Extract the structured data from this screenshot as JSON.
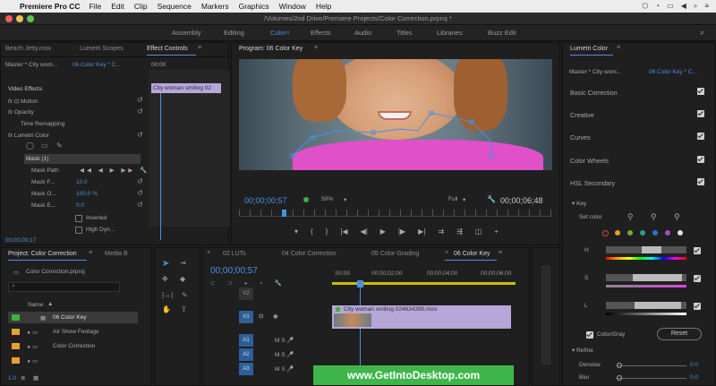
{
  "menubar": {
    "app": "Premiere Pro CC",
    "items": [
      "File",
      "Edit",
      "Clip",
      "Sequence",
      "Markers",
      "Graphics",
      "Window",
      "Help"
    ]
  },
  "window": {
    "title": "/Volumes/2nd Drive/Premiere Projects/Color Correction.prproj *"
  },
  "workspaces": [
    "Assembly",
    "Editing",
    "Color",
    "Effects",
    "Audio",
    "Titles",
    "Libraries",
    "Buzz Edit"
  ],
  "left_panel": {
    "tabs": [
      "Beach Jetty.mov",
      "Lumetri Scopes",
      "Effect Controls"
    ],
    "master": "Master * City wom...",
    "sequence": "06 Color Key * C...",
    "ruler_start": "00:00",
    "clip_bar": "City woman smiling 02",
    "video_effects": "Video Effects",
    "motion": "Motion",
    "opacity": "Opacity",
    "time_remapping": "Time Remapping",
    "lumetri": "Lumetri Color",
    "mask": "Mask (1)",
    "mask_path": "Mask Path",
    "mask_feather_label": "Mask F...",
    "mask_feather_val": "10.0",
    "mask_opacity_label": "Mask O...",
    "mask_opacity_val": "100.0 %",
    "mask_expansion_label": "Mask E...",
    "mask_expansion_val": "0.0",
    "inverted": "Inverted",
    "high_dyn": "High Dyn...",
    "timecode": "00;00;00;17"
  },
  "program": {
    "title": "Program: 06 Color Key",
    "timecode_in": "00;00;00;57",
    "zoom": "50%",
    "quality": "Full",
    "timecode_out": "00;00;06;48"
  },
  "lumetri_panel": {
    "title": "Lumetri Color",
    "master": "Master * City wom...",
    "sequence": "06 Color Key * C...",
    "sections": [
      "Basic Correction",
      "Creative",
      "Curves",
      "Color Wheels",
      "HSL Secondary"
    ],
    "key": "Key",
    "set_color": "Set color",
    "h": "H",
    "s": "S",
    "l": "L",
    "color_gray": "Color/Gray",
    "reset": "Reset",
    "refine": "Refine",
    "denoise": "Denoise",
    "denoise_val": "0.0",
    "blur": "Blur",
    "blur_val": "0.0",
    "colors": [
      "#e04040",
      "#e0a020",
      "#70b030",
      "#30a080",
      "#3070d0",
      "#a050c0",
      "#e0e0e0"
    ]
  },
  "project": {
    "tabs": [
      "Project: Color Correction",
      "Media B"
    ],
    "file": "Color Correction.prproj",
    "column": "Name",
    "items": [
      {
        "name": "06 Color Key",
        "color": "#3cb043"
      },
      {
        "name": "Air Show Footage",
        "color": "#e8a030"
      },
      {
        "name": "Color Correction",
        "color": "#e8a030"
      },
      {
        "name": "",
        "color": "#e8a030"
      }
    ],
    "zoom": "1.0"
  },
  "timeline": {
    "tabs": [
      "02 LUTs",
      "04 Color Correction",
      "05 Color Grading",
      "06 Color Key"
    ],
    "timecode": "00;00;00;57",
    "ruler": [
      ":00;00",
      "00;00;02;00",
      "00;00;04;00",
      "00;00;06;00"
    ],
    "tracks_video": [
      "V2",
      "V1"
    ],
    "tracks_audio": [
      "A1",
      "A2",
      "A3"
    ],
    "clip": "City woman smiling 024634390.mov"
  },
  "watermark": "www.GetIntoDesktop.com"
}
